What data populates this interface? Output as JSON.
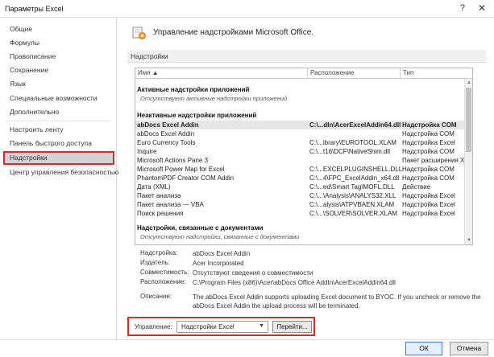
{
  "window": {
    "title": "Параметры Excel",
    "help_glyph": "?",
    "close_glyph": "✕"
  },
  "sidebar": {
    "items": [
      {
        "label": "Общие"
      },
      {
        "label": "Формулы"
      },
      {
        "label": "Правописание"
      },
      {
        "label": "Сохранение"
      },
      {
        "label": "Язык"
      },
      {
        "label": "Специальные возможности"
      },
      {
        "label": "Дополнительно"
      },
      {
        "label": "Настроить ленту"
      },
      {
        "label": "Панель быстрого доступа"
      },
      {
        "label": "Надстройки",
        "selected": true
      },
      {
        "label": "Центр управления безопасностью"
      }
    ]
  },
  "header": {
    "title": "Управление надстройками Microsoft Office.",
    "icon": "addins-gear-icon"
  },
  "section": {
    "title": "Надстройки"
  },
  "table": {
    "columns": [
      "Имя ▲",
      "Расположение",
      "Тип"
    ],
    "active_group": "Активные надстройки приложений",
    "active_note": "Отсутствуют активные надстройки приложений",
    "inactive_group": "Неактивные надстройки приложений",
    "inactive_rows": [
      {
        "name": "abDocs Excel Addin",
        "location": "C:\\...dIn\\AcerExcelAddin64.dll",
        "type": "Надстройка COM",
        "selected": true
      },
      {
        "name": "abDocs Excel Addin",
        "location": "",
        "type": "Надстройка COM"
      },
      {
        "name": "Euro Currency Tools",
        "location": "C:\\...ibrary\\EUROTOOL.XLAM",
        "type": "Надстройка Excel"
      },
      {
        "name": "Inquire",
        "location": "C:\\...t16\\DCF\\NativeShim.dll",
        "type": "Надстройка COM"
      },
      {
        "name": "Microsoft Actions Pane 3",
        "location": "",
        "type": "Пакет расширения XML"
      },
      {
        "name": "Microsoft Power Map for Excel",
        "location": "C:\\...EXCELPLUGINSHELL.DLL",
        "type": "Надстройка COM"
      },
      {
        "name": "PhantomPDF Creator COM Addin",
        "location": "C:\\...4\\FPC_ExcelAddin_x64.dll",
        "type": "Надстройка COM"
      },
      {
        "name": "Дата (XML)",
        "location": "C:\\...ed\\Smart Tag\\MOFL.DLL",
        "type": "Действие"
      },
      {
        "name": "Пакет анализа",
        "location": "C:\\...\\Analysis\\ANALYS32.XLL",
        "type": "Надстройка Excel"
      },
      {
        "name": "Пакет анализа — VBA",
        "location": "C:\\...alysis\\ATPVBAEN.XLAM",
        "type": "Надстройка Excel"
      },
      {
        "name": "Поиск решения",
        "location": "C:\\...\\SOLVER\\SOLVER.XLAM",
        "type": "Надстройка Excel"
      }
    ],
    "doc_group": "Надстройки, связанные с документами",
    "doc_note": "Отсутствуют надстройки, связанные с документами"
  },
  "details": {
    "addin_label": "Надстройка:",
    "addin_value": "abDocs Excel Addin",
    "publisher_label": "Издатель:",
    "publisher_value": "Acer Incorporated",
    "compat_label": "Совместимость:",
    "compat_value": "Отсутствуют сведения о совместимости",
    "location_label": "Расположение:",
    "location_value": "C:\\Program Files (x86)\\Acer\\abDocs Office AddIn\\AcerExcelAddin64.dll",
    "description_label": "Описание:",
    "description_value": "The abDocs Excel Addin supports uploading Excel document to BYOC. If you uncheck or remove the abDocs Excel Addin the upload process will be terminated."
  },
  "manage": {
    "label": "Управление:",
    "selected": "Надстройки Excel",
    "go_label": "Перейти..."
  },
  "footer": {
    "ok_label": "ОК",
    "cancel_label": "Отмена"
  }
}
